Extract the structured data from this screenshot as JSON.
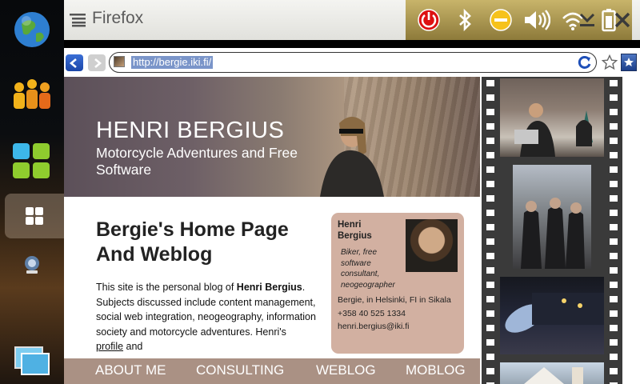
{
  "window": {
    "title": "Firefox"
  },
  "sidebar": {
    "items": [
      {
        "name": "globe-icon"
      },
      {
        "name": "contacts-icon"
      },
      {
        "name": "apps-icon"
      },
      {
        "name": "dashboard-icon"
      },
      {
        "name": "connectivity-icon"
      },
      {
        "name": "task-switcher-icon"
      }
    ]
  },
  "statusbar": {
    "icons": [
      "power-icon",
      "bluetooth-icon",
      "presence-icon",
      "volume-icon",
      "wifi-icon",
      "battery-icon"
    ]
  },
  "toolbar": {
    "minimize_icon": "chevron-down-icon",
    "close_icon": "close-icon"
  },
  "urlbar": {
    "url": "http://bergie.iki.fi/"
  },
  "page": {
    "site_title": "HENRI BERGIUS",
    "site_subtitle": "Motorcycle Adventures and Free Software",
    "heading": "Bergie's Home Page And Weblog",
    "intro_p1": "This site is the personal blog of ",
    "intro_name": "Henri Bergius",
    "intro_p2": ". Subjects discussed include content management, social web integration, neogeography, information society and motorcycle adventures. Henri's ",
    "intro_link": "profile",
    "intro_p3": " and",
    "card": {
      "name": "Henri Bergius",
      "tagline": "Biker, free software consultant, neogeographer",
      "location": "Bergie, in Helsinki, FI in Sikala",
      "phone": "+358 40 525 1334",
      "email": "henri.bergius@iki.fi"
    },
    "nav": [
      "ABOUT ME",
      "CONSULTING",
      "WEBLOG",
      "MOBLOG"
    ]
  },
  "colors": {
    "accent": "#1b46a8",
    "banner": "#6d5f66",
    "card": "#d2b0a1",
    "nav_strip": "#aa9184"
  }
}
